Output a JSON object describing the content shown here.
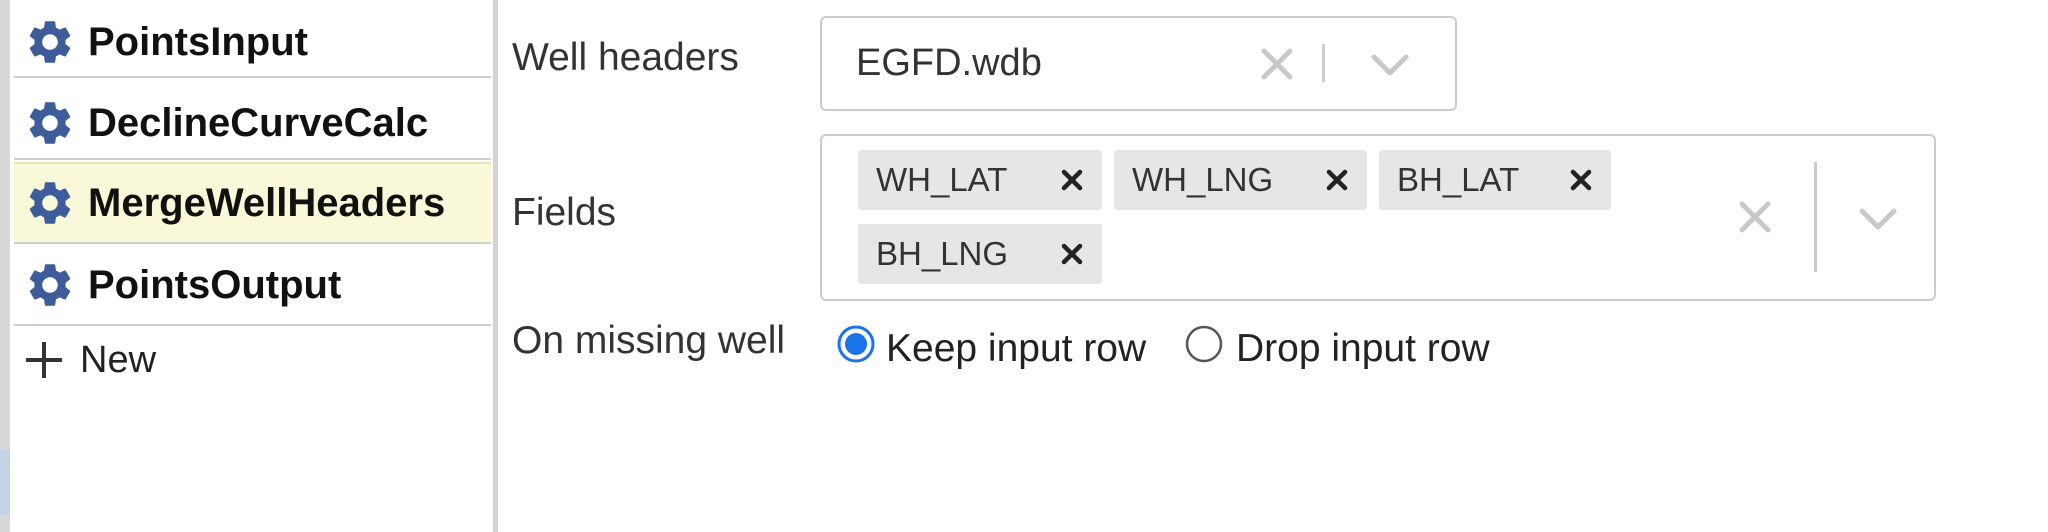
{
  "sidebar": {
    "steps": [
      {
        "label": "PointsInput",
        "icon": "gear-icon"
      },
      {
        "label": "DeclineCurveCalc",
        "icon": "gear-icon"
      },
      {
        "label": "MergeWellHeaders",
        "icon": "gear-icon",
        "selected": true
      },
      {
        "label": "PointsOutput",
        "icon": "gear-icon"
      }
    ],
    "new_label": "New"
  },
  "form": {
    "well_headers": {
      "label": "Well headers",
      "value": "EGFD.wdb"
    },
    "fields": {
      "label": "Fields",
      "values": [
        "WH_LAT",
        "WH_LNG",
        "BH_LAT",
        "BH_LNG"
      ]
    },
    "on_missing_well": {
      "label": "On missing well",
      "options": [
        {
          "label": "Keep input row",
          "checked": true
        },
        {
          "label": "Drop input row",
          "checked": false
        }
      ]
    }
  },
  "colors": {
    "selected_row": "#f9f8d8",
    "gear": "#3f5c9a",
    "radio_accent": "#1a73e8"
  }
}
